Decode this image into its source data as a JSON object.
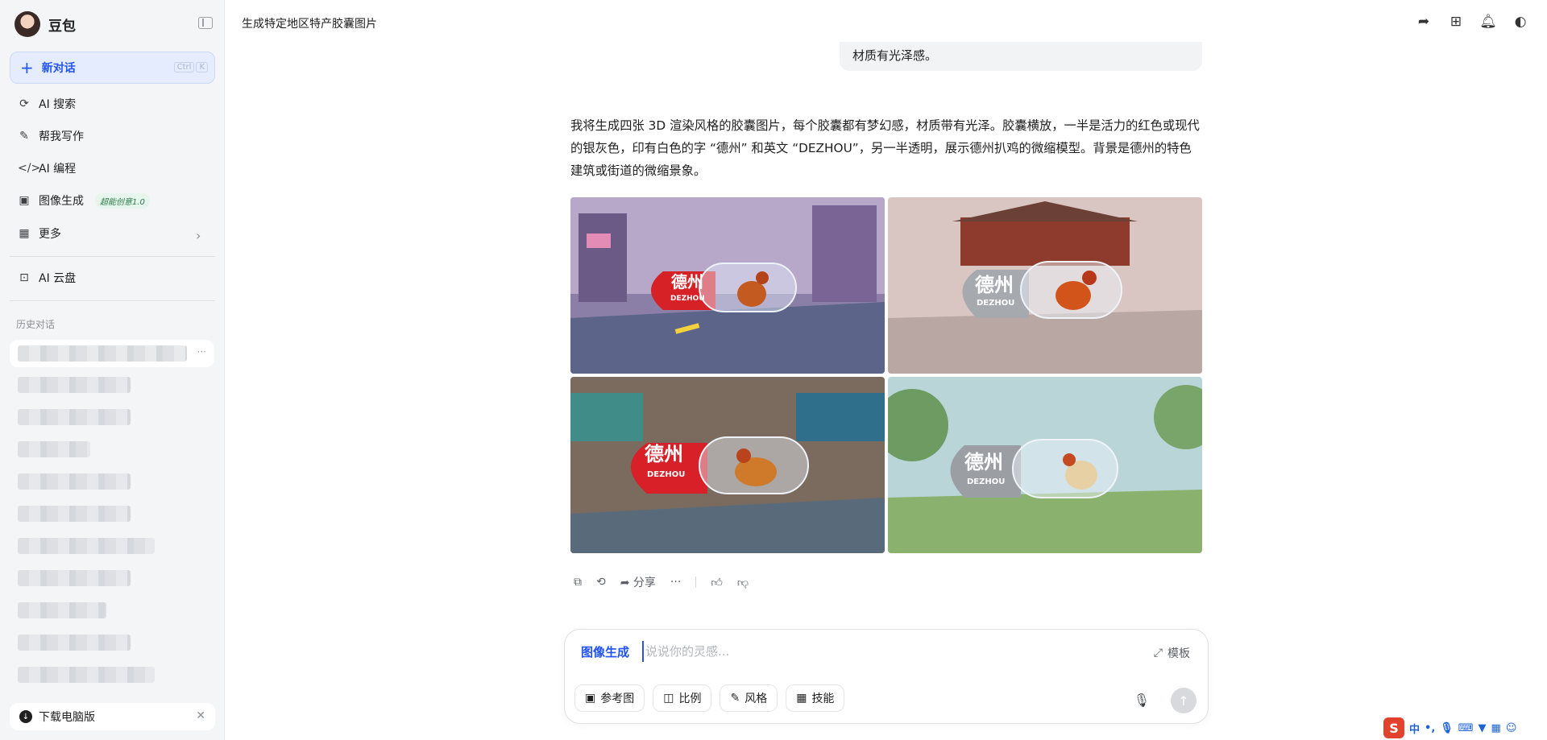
{
  "app": {
    "name": "豆包"
  },
  "sidebar": {
    "new_chat": "新对话",
    "shortcut": [
      "Ctrl",
      "K"
    ],
    "items": [
      {
        "label": "AI 搜索",
        "icon": "ai-search-icon"
      },
      {
        "label": "帮我写作",
        "icon": "pen-icon"
      },
      {
        "label": "AI 编程",
        "icon": "code-icon"
      },
      {
        "label": "图像生成",
        "icon": "image-icon",
        "badge": "超能创意1.0"
      },
      {
        "label": "更多",
        "icon": "grid-icon"
      }
    ],
    "cloud": "AI 云盘",
    "history_title": "历史对话",
    "download": "下载电脑版"
  },
  "conversation": {
    "title": "生成特定地区特产胶囊图片",
    "user_message_tail": "材质有光泽感。",
    "answer": "我将生成四张 3D 渲染风格的胶囊图片，每个胶囊都有梦幻感，材质带有光泽。胶囊横放，一半是活力的红色或现代的银灰色，印有白色的字 “德州” 和英文 “DEZHOU”，另一半透明，展示德州扒鸡的微缩模型。背景是德州的特色建筑或街道的微缩景象。",
    "images": [
      {
        "cn": "德州",
        "en": "DEZHOU",
        "color": "red",
        "scene": "street"
      },
      {
        "cn": "德州",
        "en": "DEZHOU",
        "color": "silver",
        "scene": "temple"
      },
      {
        "cn": "德州",
        "en": "DEZHOU",
        "color": "red",
        "scene": "market"
      },
      {
        "cn": "德州",
        "en": "DEZHOU",
        "color": "silver",
        "scene": "park"
      }
    ],
    "share_label": "分享"
  },
  "composer": {
    "mode": "图像生成",
    "placeholder": "说说你的灵感...",
    "template": "模板",
    "tools": [
      "参考图",
      "比例",
      "风格",
      "技能"
    ]
  },
  "ime": {
    "label": "中"
  }
}
